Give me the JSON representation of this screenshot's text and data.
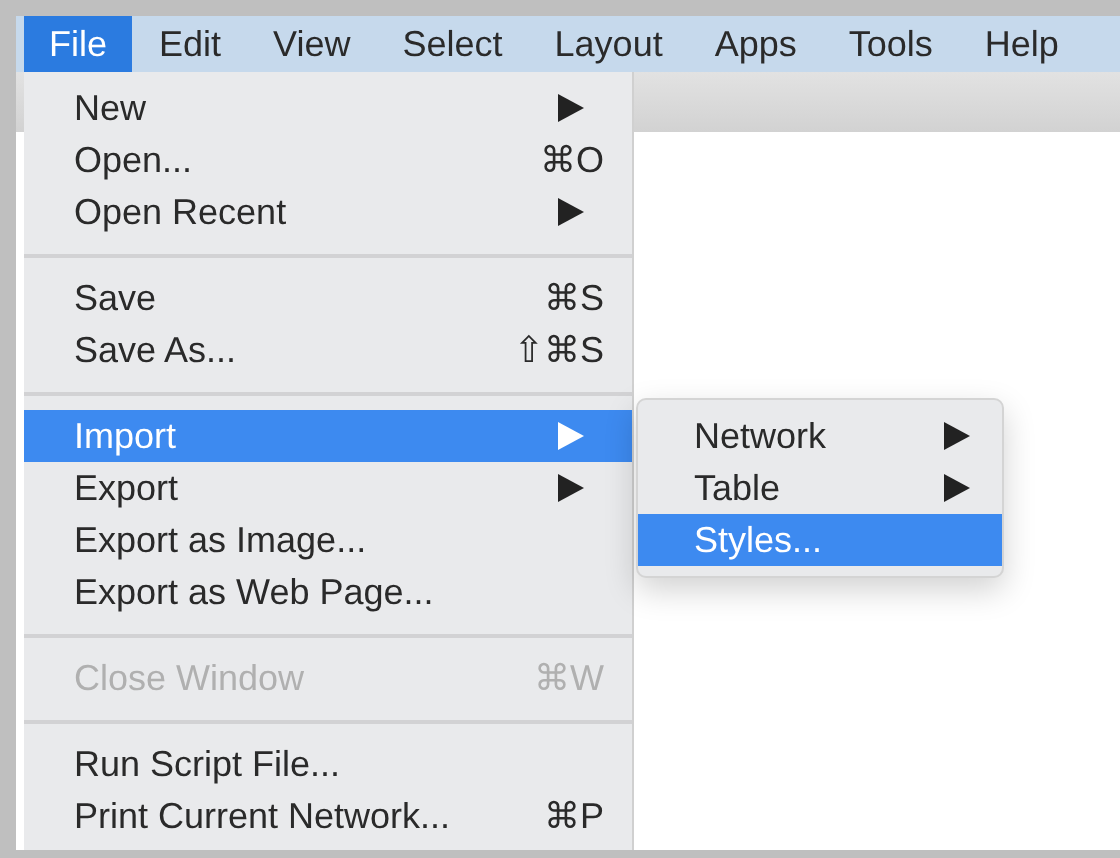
{
  "menubar": [
    {
      "label": "File",
      "selected": true
    },
    {
      "label": "Edit",
      "selected": false
    },
    {
      "label": "View",
      "selected": false
    },
    {
      "label": "Select",
      "selected": false
    },
    {
      "label": "Layout",
      "selected": false
    },
    {
      "label": "Apps",
      "selected": false
    },
    {
      "label": "Tools",
      "selected": false
    },
    {
      "label": "Help",
      "selected": false
    }
  ],
  "file_menu": [
    {
      "kind": "item",
      "label": "New",
      "submenu": true,
      "selected": false,
      "disabled": false
    },
    {
      "kind": "item",
      "label": "Open...",
      "shortcut": "⌘O",
      "selected": false,
      "disabled": false
    },
    {
      "kind": "item",
      "label": "Open Recent",
      "submenu": true,
      "selected": false,
      "disabled": false
    },
    {
      "kind": "separator"
    },
    {
      "kind": "item",
      "label": "Save",
      "shortcut": "⌘S",
      "selected": false,
      "disabled": false
    },
    {
      "kind": "item",
      "label": "Save As...",
      "shortcut": "⇧⌘S",
      "selected": false,
      "disabled": false
    },
    {
      "kind": "separator"
    },
    {
      "kind": "item",
      "label": "Import",
      "submenu": true,
      "selected": true,
      "disabled": false
    },
    {
      "kind": "item",
      "label": "Export",
      "submenu": true,
      "selected": false,
      "disabled": false
    },
    {
      "kind": "item",
      "label": "Export as Image...",
      "selected": false,
      "disabled": false
    },
    {
      "kind": "item",
      "label": "Export as Web Page...",
      "selected": false,
      "disabled": false
    },
    {
      "kind": "separator"
    },
    {
      "kind": "item",
      "label": "Close Window",
      "shortcut": "⌘W",
      "selected": false,
      "disabled": true
    },
    {
      "kind": "separator"
    },
    {
      "kind": "item",
      "label": "Run Script File...",
      "selected": false,
      "disabled": false
    },
    {
      "kind": "item",
      "label": "Print Current Network...",
      "shortcut": "⌘P",
      "selected": false,
      "disabled": false
    }
  ],
  "import_submenu": [
    {
      "kind": "item",
      "label": "Network",
      "submenu": true,
      "selected": false,
      "disabled": false
    },
    {
      "kind": "item",
      "label": "Table",
      "submenu": true,
      "selected": false,
      "disabled": false
    },
    {
      "kind": "item",
      "label": "Styles...",
      "selected": true,
      "disabled": false
    }
  ]
}
